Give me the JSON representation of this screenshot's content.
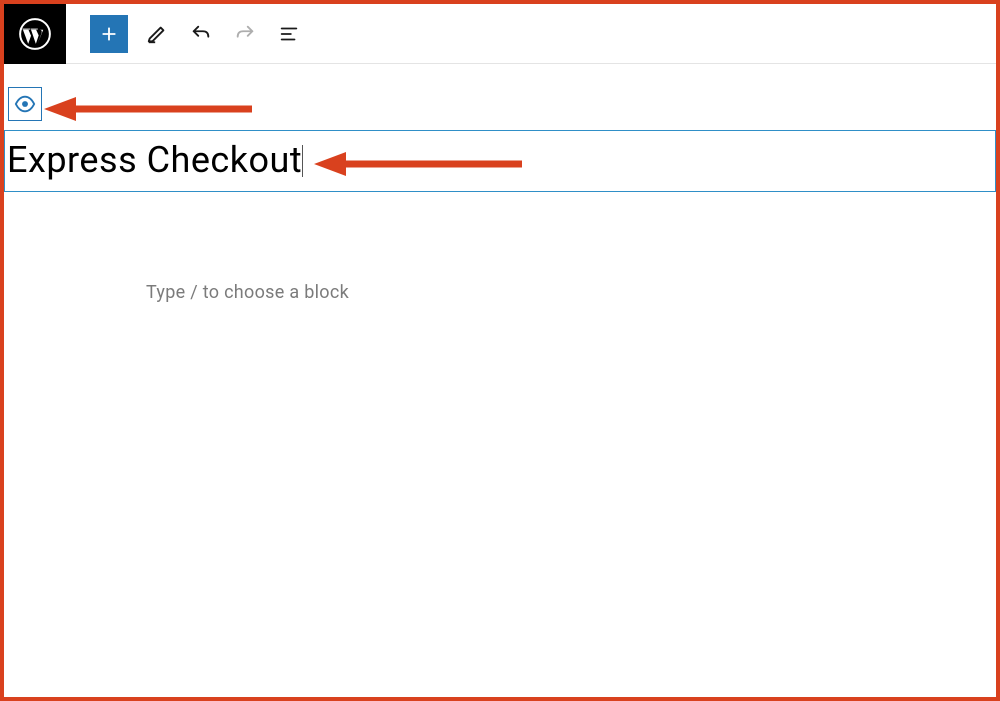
{
  "toolbar": {
    "wp_logo_label": "WordPress",
    "add_label": "Add block",
    "draw_label": "Tools",
    "undo_label": "Undo",
    "redo_label": "Redo",
    "details_label": "Details"
  },
  "visibility": {
    "toggle_label": "Visibility"
  },
  "title": {
    "value": "Express Checkout"
  },
  "editor": {
    "placeholder": "Type / to choose a block"
  },
  "annotations": {
    "arrow1_target": "visibility-toggle",
    "arrow2_target": "title-field"
  }
}
